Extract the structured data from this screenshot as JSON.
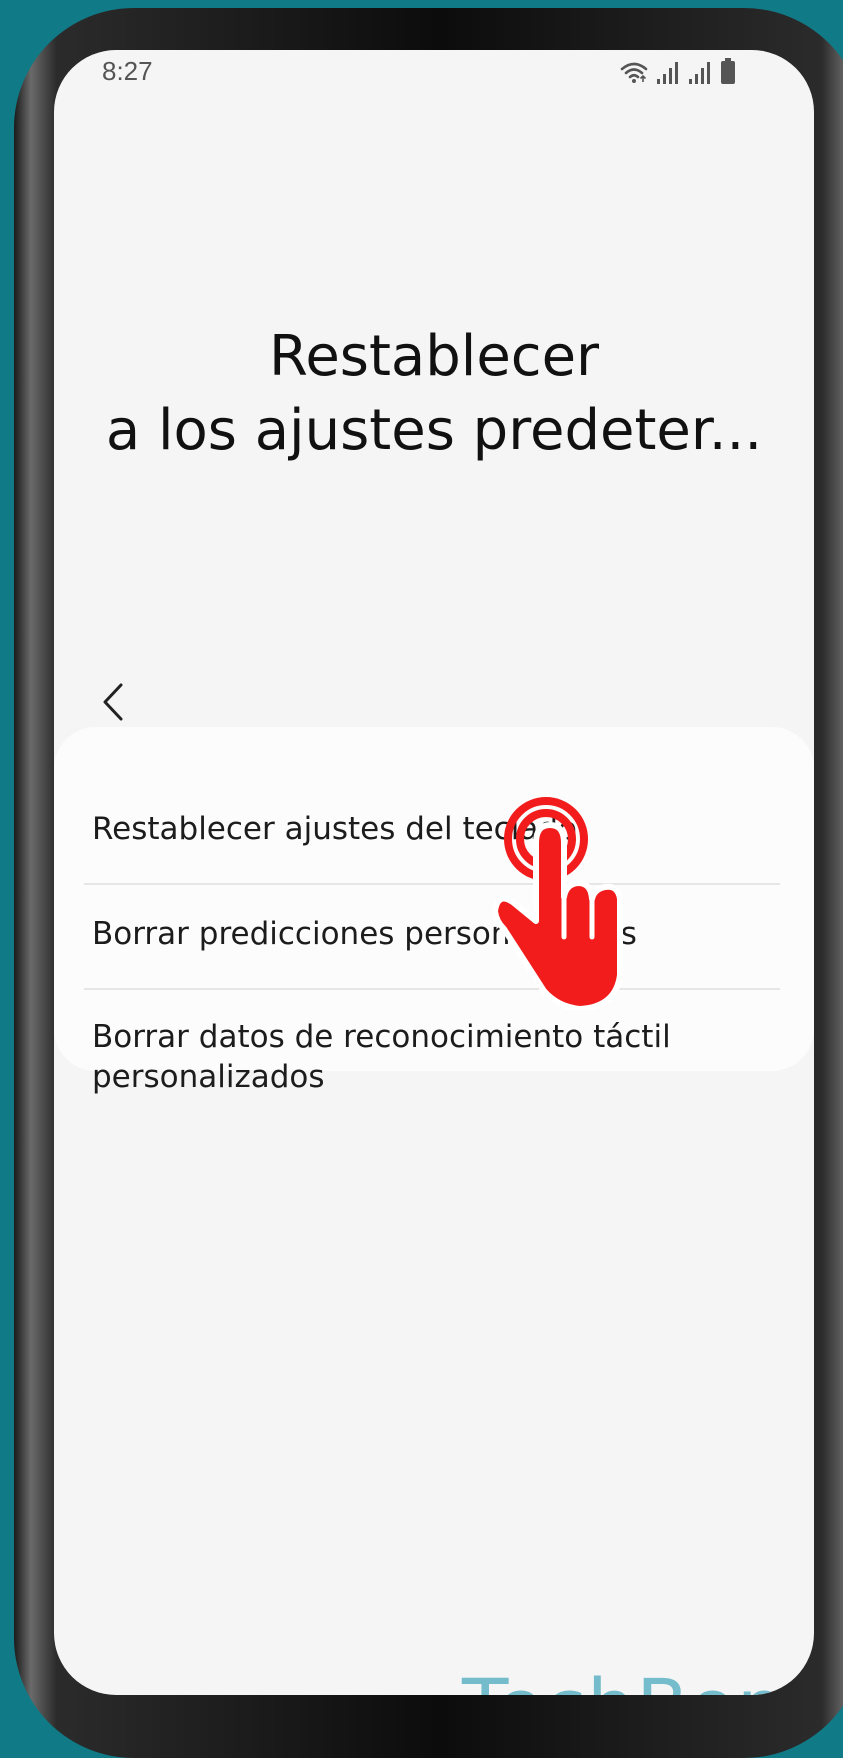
{
  "status_bar": {
    "time": "8:27",
    "icons": [
      "wifi-icon",
      "signal-icon",
      "signal-icon",
      "battery-icon"
    ]
  },
  "page": {
    "title_line1": "Restablecer",
    "title_line2": "a los ajustes predeter..."
  },
  "navigation": {
    "back_icon": "chevron-left-icon"
  },
  "settings": {
    "items": [
      {
        "label": "Restablecer ajustes del teclado"
      },
      {
        "label": "Borrar predicciones personalizadas"
      },
      {
        "label": "Borrar datos de reconocimiento táctil personalizados"
      }
    ]
  },
  "overlay": {
    "tap_indicator_icon": "tap-hand-icon",
    "tap_color": "#f21c1c"
  },
  "watermark": {
    "text": "TechBone",
    "color": "#6ab8c8"
  },
  "colors": {
    "background": "#117a87",
    "screen": "#f5f5f5",
    "card": "#fcfcfc"
  }
}
